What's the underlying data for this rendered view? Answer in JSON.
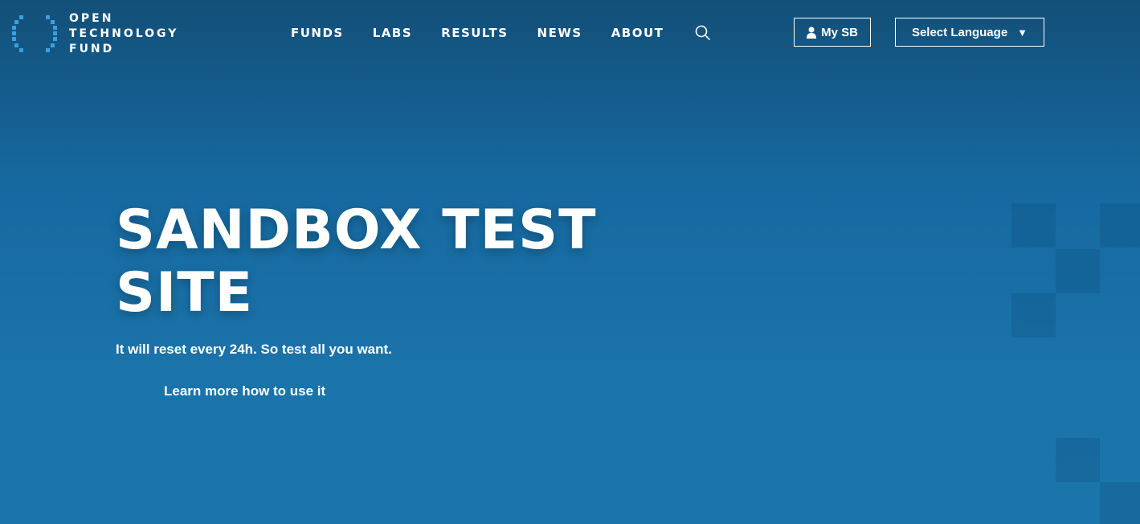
{
  "logo": {
    "line1": "OPEN",
    "line2": "TECHNOLOGY",
    "line3": "FUND"
  },
  "nav": {
    "items": [
      "FUNDS",
      "LABS",
      "RESULTS",
      "NEWS",
      "ABOUT"
    ],
    "search_icon": "search-icon"
  },
  "account": {
    "label": "My SB",
    "icon": "user-icon"
  },
  "language": {
    "label": "Select Language",
    "caret": "▼"
  },
  "hero": {
    "title_line1": "SANDBOX TEST",
    "title_line2": "SITE",
    "subtitle": "It will reset every 24h. So test all you want.",
    "link": "Learn more how to use it"
  },
  "colors": {
    "background": "#1a73a9",
    "header_top": "#134f78",
    "logo_accent": "#3aa0e0",
    "text": "#ffffff"
  }
}
